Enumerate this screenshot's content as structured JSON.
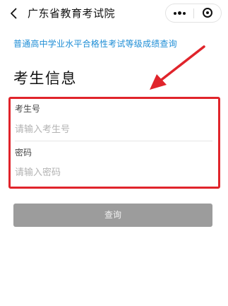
{
  "navbar": {
    "title": "广东省教育考试院",
    "back_icon": "chevron-left-icon",
    "more_icon": "more-dots-icon",
    "close_icon": "target-circle-icon"
  },
  "subtitle": "普通高中学业水平合格性考试等级成绩查询",
  "section_title": "考生信息",
  "form": {
    "exam_id": {
      "label": "考生号",
      "placeholder": "请输入考生号",
      "value": ""
    },
    "password": {
      "label": "密码",
      "placeholder": "请输入密码",
      "value": ""
    }
  },
  "query_button": {
    "label": "查询"
  },
  "colors": {
    "accent_link": "#1f8ed6",
    "highlight_red": "#e0242b",
    "button_gray": "#9c9c9c"
  }
}
